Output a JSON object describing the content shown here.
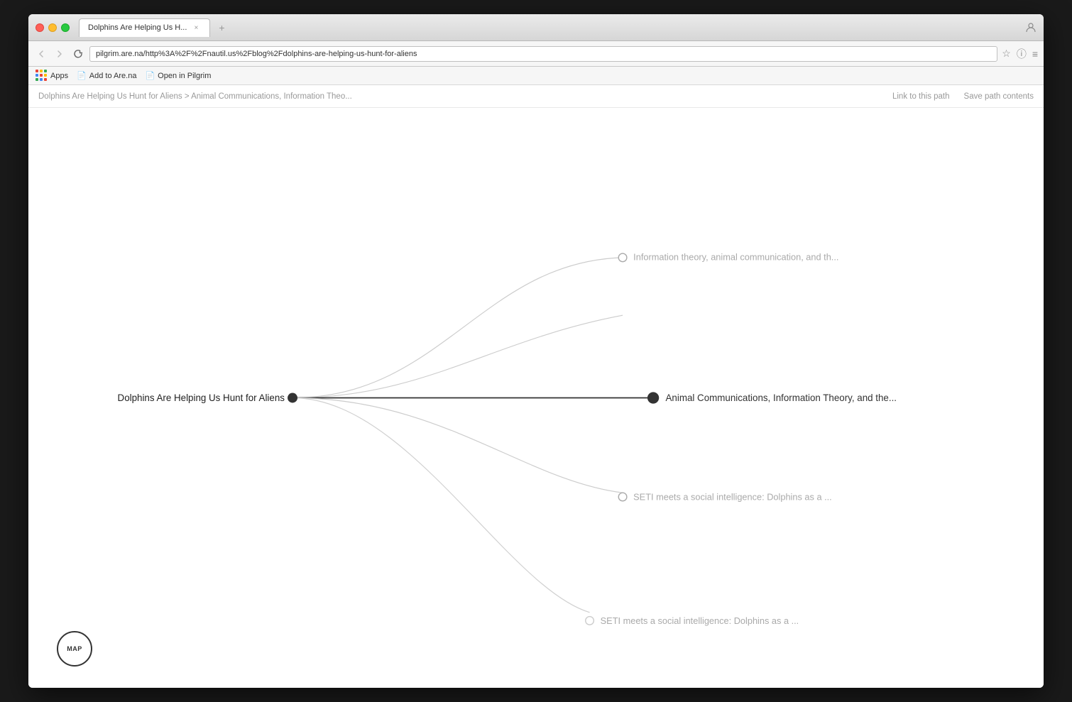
{
  "browser": {
    "title": "Dolphins Are Helping Us H...",
    "tab_close": "×",
    "tab_new": "+",
    "url": "pilgrim.are.na/http%3A%2F%2Fnautil.us%2Fblog%2Fdolphins-are-helping-us-hunt-for-aliens",
    "back_label": "‹",
    "forward_label": "›",
    "reload_label": "↻",
    "bookmark_star": "☆",
    "info_icon": "ⓘ",
    "menu_icon": "≡",
    "user_icon": "👤"
  },
  "bookmarks": {
    "apps_label": "Apps",
    "item1_label": "Add to Are.na",
    "item2_label": "Open in Pilgrim"
  },
  "breadcrumb": {
    "text": "Dolphins Are Helping Us Hunt for Aliens > Animal Communications, Information Theo...",
    "link_action": "Link to this path",
    "save_action": "Save path contents"
  },
  "graph": {
    "left_node_label": "Dolphins Are Helping Us Hunt for Aliens",
    "center_node_label": "Animal Communications, Information Theory, and the...",
    "top_node_label": "Information theory, animal communication, and th...",
    "mid_node_label": "SETI meets a social intelligence: Dolphins as a ...",
    "bottom_node_label": "SETI meets a social intelligence: Dolphins as a ..."
  },
  "map_button": {
    "label": "MAP"
  },
  "colors": {
    "line_color": "#cccccc",
    "active_line_color": "#333333",
    "node_fill_dark": "#333333",
    "node_fill_light": "#ffffff",
    "node_stroke": "#aaaaaa"
  }
}
